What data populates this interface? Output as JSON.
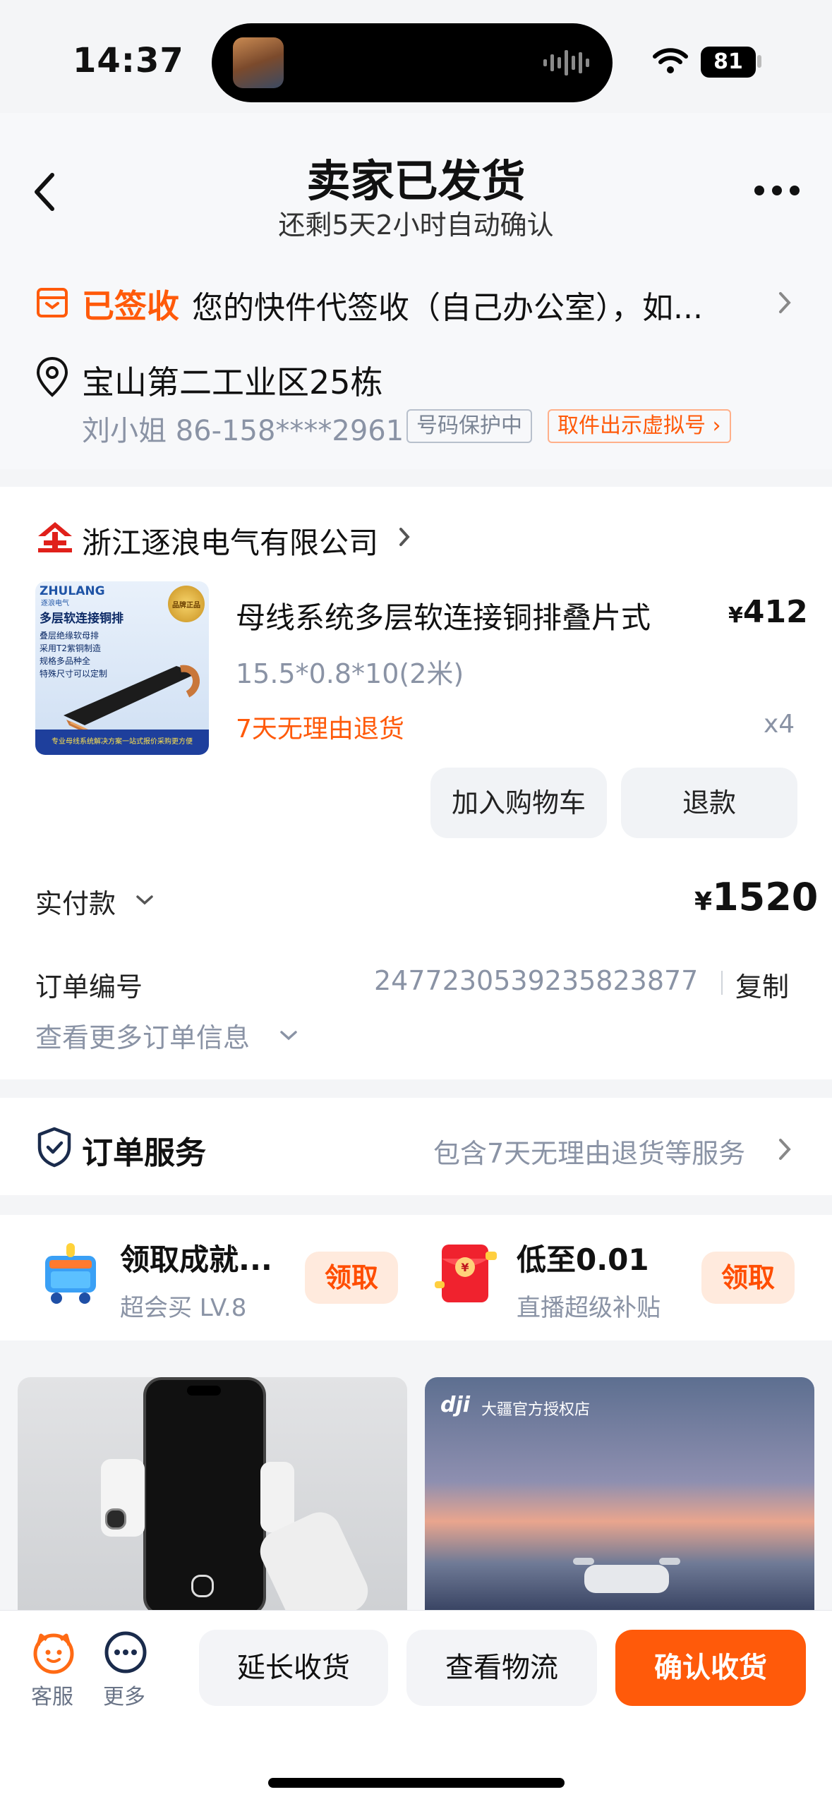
{
  "status": {
    "time": "14:37",
    "battery": "81"
  },
  "header": {
    "title": "卖家已发货",
    "subtitle": "还剩5天2小时自动确认"
  },
  "notice": {
    "tag": "已签收",
    "text": "您的快件代签收（自己办公室），如..."
  },
  "address": {
    "line": "宝山第二工业区25栋",
    "contact": "刘小姐 86-158****2961",
    "protect_badge": "号码保护中",
    "virtual_btn": "取件出示虚拟号 ›"
  },
  "store": {
    "name": "浙江逐浪电气有限公司"
  },
  "product": {
    "title": "母线系统多层软连接铜排叠片式",
    "price": "412",
    "spec": "15.5*0.8*10(2米)",
    "return_policy": "7天无理由退货",
    "qty": "x4",
    "image": {
      "brand": "ZHULANG",
      "brand_sub": "逐浪电气",
      "heading": "多层软连接铜排",
      "features": [
        "叠层绝缘软母排",
        "采用T2紫铜制造",
        "规格多品种全",
        "特殊尺寸可以定制"
      ],
      "badge": "品牌正品",
      "banner": "专业母线系统解决方案一站式报价采购更方便"
    },
    "btn_cart": "加入购物车",
    "btn_refund": "退款"
  },
  "payment": {
    "label": "实付款",
    "currency": "¥",
    "amount": "1520"
  },
  "order": {
    "number_label": "订单编号",
    "number": "2477230539235823877",
    "copy": "复制",
    "more": "查看更多订单信息"
  },
  "service": {
    "label": "订单服务",
    "desc": "包含7天无理由退货等服务"
  },
  "promos": [
    {
      "title": "领取成就...",
      "sub": "超会买 LV.8",
      "btn": "领取"
    },
    {
      "title": "低至0.01",
      "sub": "直播超级补贴",
      "btn": "领取"
    }
  ],
  "ads": {
    "right_caption": "大疆官方授权店"
  },
  "bottom": {
    "service": "客服",
    "more": "更多",
    "extend": "延长收货",
    "logistics": "查看物流",
    "confirm": "确认收货"
  },
  "colors": {
    "accent": "#ff5a0a",
    "muted": "#8a93a5"
  }
}
